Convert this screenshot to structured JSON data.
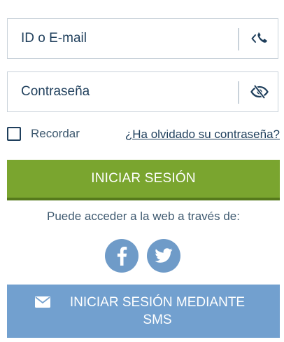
{
  "login_form": {
    "id_field": {
      "placeholder": "ID o E-mail",
      "suffix_icon": "phone-back-icon"
    },
    "password_field": {
      "placeholder": "Contraseña",
      "suffix_icon": "eye-slash-icon"
    },
    "remember_label": "Recordar",
    "remember_checked": false,
    "forgot_link": "¿Ha olvidado su contraseña?",
    "submit_label": "INICIAR SESIÓN"
  },
  "social": {
    "caption": "Puede acceder a la web a través de:",
    "buttons": [
      {
        "icon": "facebook-icon"
      },
      {
        "icon": "twitter-icon"
      }
    ]
  },
  "sms_login": {
    "icon": "envelope-icon",
    "label": "INICIAR SESIÓN MEDIANTE SMS"
  },
  "colors": {
    "primary_text": "#1f3f5c",
    "login_green": "#7aa52f",
    "social_blue": "#6f9bc8",
    "sms_blue": "#72a0cf"
  }
}
